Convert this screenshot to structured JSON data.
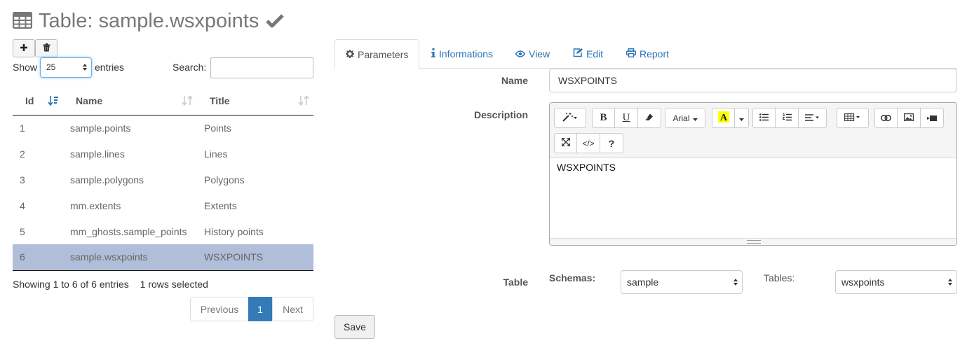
{
  "page": {
    "title": "Table: sample.wsxpoints",
    "icons": {
      "title": "table-icon",
      "status": "check-icon"
    }
  },
  "toolbar": {
    "add_icon": "plus-icon",
    "delete_icon": "trash-icon"
  },
  "list": {
    "show_label": "Show",
    "show_value": "25",
    "entries_label": "entries",
    "search_label": "Search:",
    "search_value": "",
    "columns": [
      "Id",
      "Name",
      "Title"
    ],
    "rows": [
      {
        "id": "1",
        "name": "sample.points",
        "title": "Points"
      },
      {
        "id": "2",
        "name": "sample.lines",
        "title": "Lines"
      },
      {
        "id": "3",
        "name": "sample.polygons",
        "title": "Polygons"
      },
      {
        "id": "4",
        "name": "mm.extents",
        "title": "Extents"
      },
      {
        "id": "5",
        "name": "mm_ghosts.sample_points",
        "title": "History points"
      },
      {
        "id": "6",
        "name": "sample.wsxpoints",
        "title": "WSXPOINTS"
      }
    ],
    "selected_row": "6",
    "info": "Showing 1 to 6 of 6 entries",
    "selection_info": "1 rows selected",
    "pagination": {
      "previous": "Previous",
      "current": "1",
      "next": "Next"
    }
  },
  "tabs": [
    {
      "label": "Parameters",
      "icon": "gear-icon",
      "active": true
    },
    {
      "label": "Informations",
      "icon": "info-icon",
      "active": false
    },
    {
      "label": "View",
      "icon": "eye-icon",
      "active": false
    },
    {
      "label": "Edit",
      "icon": "edit-icon",
      "active": false
    },
    {
      "label": "Report",
      "icon": "print-icon",
      "active": false
    }
  ],
  "form": {
    "name_label": "Name",
    "name_value": "WSXPOINTS",
    "description_label": "Description",
    "description_value": "WSXPOINTS",
    "editor": {
      "font_name": "Arial",
      "buttons": [
        "magic-icon",
        "bold-icon",
        "underline-icon",
        "eraser-icon",
        "font-family-select",
        "highlight-color-icon",
        "color-dropdown",
        "unordered-list-icon",
        "ordered-list-icon",
        "align-icon",
        "table-icon",
        "link-icon",
        "image-icon",
        "video-icon",
        "fullscreen-icon",
        "code-view-icon",
        "help-icon"
      ],
      "bold": "B",
      "underline": "U",
      "help": "?",
      "code": "</>"
    },
    "table_label": "Table",
    "schemas_label": "Schemas:",
    "schemas_value": "sample",
    "tables_label": "Tables:",
    "tables_value": "wsxpoints",
    "save_label": "Save"
  },
  "colors": {
    "link": "#2a73b3",
    "selected_row": "#b0bed9",
    "active_page": "#337ab7",
    "highlight": "#ffff00"
  }
}
